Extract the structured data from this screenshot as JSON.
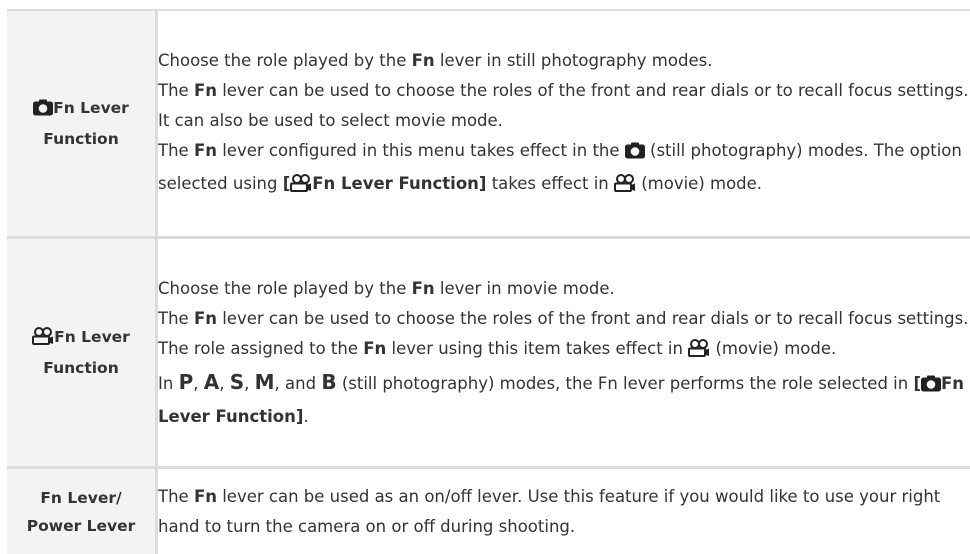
{
  "rows": [
    {
      "label_icon": "camera-icon",
      "label_line1": "Fn Lever",
      "label_line2": "Function",
      "paragraphs": {
        "p1": {
          "a": "Choose the role played by the ",
          "b": "Fn",
          "c": " lever in still photography modes."
        },
        "p2": {
          "a": "The ",
          "b": "Fn",
          "c": " lever can be used to choose the roles of the front and rear dials or to recall focus settings. It can also be used to select movie mode."
        },
        "p3": {
          "a": "The ",
          "b": "Fn",
          "c": " lever configured in this menu takes effect in the ",
          "d": " (still photography) modes. The option selected using ",
          "e_open": "[",
          "e_text": "Fn Lever Function]",
          "f": " takes effect in ",
          "g": " (movie) mode."
        }
      }
    },
    {
      "label_icon": "movie-camera-icon",
      "label_line1": "Fn Lever",
      "label_line2": "Function",
      "paragraphs": {
        "p1": {
          "a": "Choose the role played by the ",
          "b": "Fn",
          "c": " lever in movie mode."
        },
        "p2": {
          "a": "The ",
          "b": "Fn",
          "c": " lever can be used to choose the roles of the front and rear dials or to recall focus settings."
        },
        "p3": {
          "a": "The role assigned to the ",
          "b": "Fn",
          "c": " lever using this item takes effect in ",
          "d": " (movie) mode."
        },
        "p4": {
          "a": "In ",
          "m1": "P",
          "s1": ", ",
          "m2": "A",
          "s2": ", ",
          "m3": "S",
          "s3": ", ",
          "m4": "M",
          "s4": ", and ",
          "m5": "B",
          "c": " (still photography) modes, the Fn lever performs the role selected in ",
          "e_open": "[",
          "e_text": "Fn Lever Function]",
          "f": "."
        }
      }
    },
    {
      "label_line1": "Fn Lever/",
      "label_line2": "Power Lever",
      "paragraphs": {
        "p1": {
          "a": "The ",
          "b": "Fn",
          "c": " lever can be used as an on/off lever. Use this feature if you would like to use your right hand to turn the camera on or off during shooting."
        }
      }
    }
  ]
}
